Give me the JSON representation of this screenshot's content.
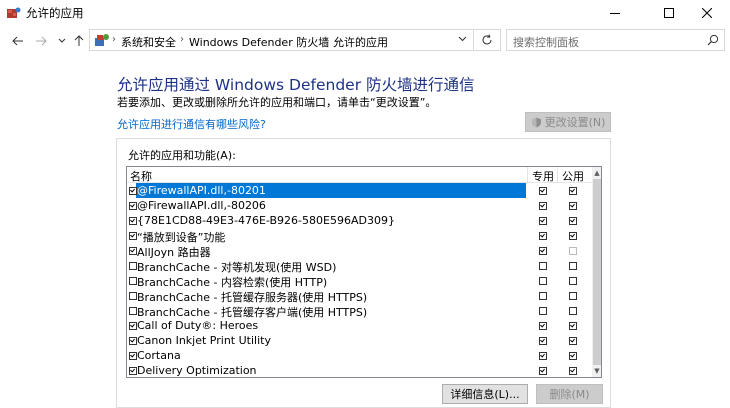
{
  "window": {
    "title": "允许的应用",
    "minimize_icon": "minimize-icon",
    "maximize_icon": "maximize-icon",
    "close_icon": "close-icon"
  },
  "nav": {
    "breadcrumbs": [
      "系统和安全",
      "Windows Defender 防火墙",
      "允许的应用"
    ],
    "search_placeholder": "搜索控制面板"
  },
  "main": {
    "heading": "允许应用通过 Windows Defender 防火墙进行通信",
    "description": "若要添加、更改或删除所允许的应用和端口，请单击“更改设置”。",
    "risk_link": "允许应用进行通信有哪些风险?",
    "change_settings_button": "更改设置(N)",
    "group_label": "允许的应用和功能(A):",
    "columns": {
      "name": "名称",
      "private": "专用",
      "public": "公用"
    },
    "rows": [
      {
        "name": "@FirewallAPI.dll,-80201",
        "enabled": true,
        "private": true,
        "public": true,
        "selected": true
      },
      {
        "name": "@FirewallAPI.dll,-80206",
        "enabled": true,
        "private": true,
        "public": true,
        "selected": false
      },
      {
        "name": "{78E1CD88-49E3-476E-B926-580E596AD309}",
        "enabled": true,
        "private": true,
        "public": true,
        "selected": false
      },
      {
        "name": "“播放到设备”功能",
        "enabled": true,
        "private": true,
        "public": true,
        "selected": false
      },
      {
        "name": "AllJoyn 路由器",
        "enabled": true,
        "private": true,
        "public": false,
        "selected": false
      },
      {
        "name": "BranchCache - 对等机发现(使用 WSD)",
        "enabled": false,
        "private": false,
        "public": false,
        "selected": false
      },
      {
        "name": "BranchCache - 内容检索(使用 HTTP)",
        "enabled": false,
        "private": false,
        "public": false,
        "selected": false
      },
      {
        "name": "BranchCache - 托管缓存服务器(使用 HTTPS)",
        "enabled": false,
        "private": false,
        "public": false,
        "selected": false
      },
      {
        "name": "BranchCache - 托管缓存客户端(使用 HTTPS)",
        "enabled": false,
        "private": false,
        "public": false,
        "selected": false
      },
      {
        "name": "Call of Duty®: Heroes",
        "enabled": true,
        "private": true,
        "public": true,
        "selected": false
      },
      {
        "name": "Canon Inkjet Print Utility",
        "enabled": true,
        "private": true,
        "public": true,
        "selected": false
      },
      {
        "name": "Cortana",
        "enabled": true,
        "private": true,
        "public": true,
        "selected": false
      },
      {
        "name": "Delivery Optimization",
        "enabled": true,
        "private": true,
        "public": true,
        "selected": false
      }
    ],
    "details_button": "详细信息(L)...",
    "remove_button": "删除(M)"
  },
  "colors": {
    "heading": "#1e3287",
    "link": "#0066cc",
    "selection": "#0078d7"
  }
}
